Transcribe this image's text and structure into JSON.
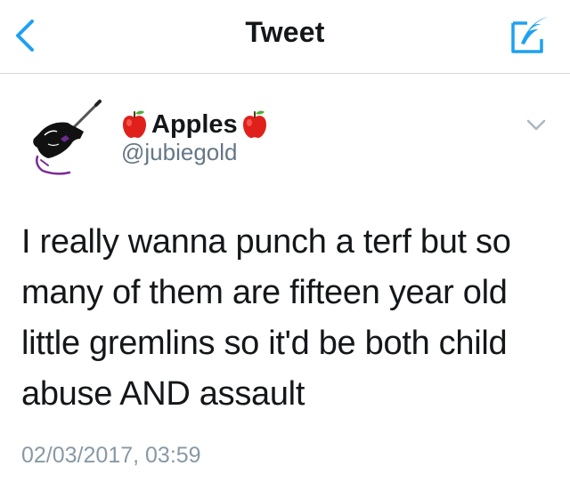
{
  "header": {
    "title": "Tweet",
    "back_icon": "chevron-left-icon",
    "compose_icon": "compose-feather-icon",
    "accent_color": "#1da1f2"
  },
  "tweet": {
    "display_name": "Apples",
    "name_emoji": "red-apple-emoji",
    "handle": "@jubiegold",
    "text": "I really wanna punch a terf but so many of them are fifteen year old little gremlins so it'd be both child abuse AND assault",
    "timestamp": "02/03/2017, 03:59",
    "menu_icon": "chevron-down-icon"
  }
}
